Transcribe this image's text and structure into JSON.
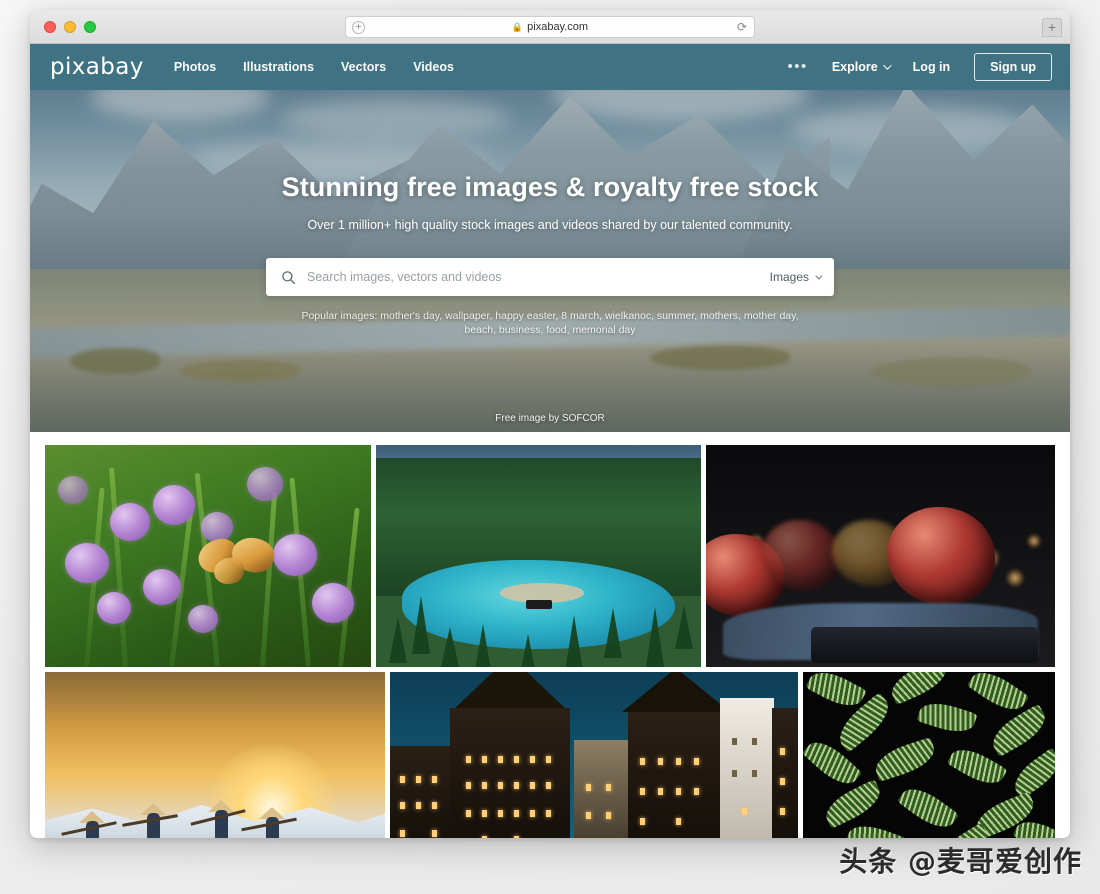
{
  "browser": {
    "url": "pixabay.com",
    "lock_icon": "lock-icon",
    "reload_icon": "reload-icon",
    "add_icon": "plus-icon",
    "new_tab_icon": "plus-icon"
  },
  "nav": {
    "logo": "pixabay",
    "links": [
      {
        "label": "Photos"
      },
      {
        "label": "Illustrations"
      },
      {
        "label": "Vectors"
      },
      {
        "label": "Videos"
      }
    ],
    "more_menu": "•••",
    "explore": "Explore",
    "login": "Log in",
    "signup": "Sign up"
  },
  "hero": {
    "title": "Stunning free images & royalty free stock",
    "subtitle": "Over 1 million+ high quality stock images and videos shared by our talented community.",
    "credit": "Free image by SOFCOR",
    "search": {
      "placeholder": "Search images, vectors and videos",
      "value": "",
      "type_selected": "Images",
      "icon": "search-icon"
    },
    "popular": "Popular images: mother's day, wallpaper, happy easter, 8 march, wielkanoc, summer, mothers, mother day, beach, business, food, memorial day"
  },
  "gallery": {
    "row1": [
      {
        "alt": "Butterfly on purple chive flowers"
      },
      {
        "alt": "Turquoise alpine lake surrounded by pine forest"
      },
      {
        "alt": "Red apples on blue cloth in dark setting"
      }
    ],
    "row2": [
      {
        "alt": "Salt harvest workers at sunset"
      },
      {
        "alt": "Half-timbered old town buildings at blue hour"
      },
      {
        "alt": "Striped tropical leaves pattern on black"
      }
    ]
  },
  "watermark": "头条 @麦哥爱创作",
  "colors": {
    "nav_teal": "#3f7383",
    "accent_white": "#ffffff",
    "page_bg": "#f2f2f2"
  }
}
